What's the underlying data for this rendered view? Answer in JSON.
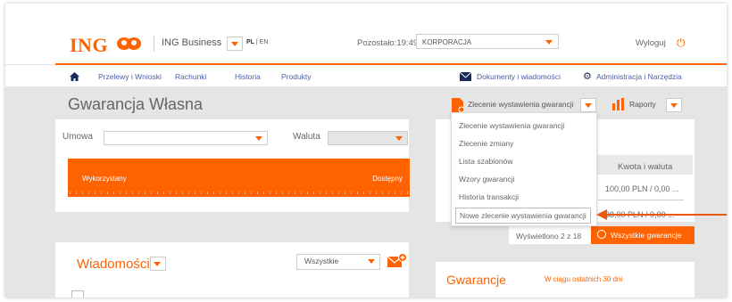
{
  "header": {
    "logo": "ING",
    "business_label": "ING Business",
    "lang_pl": "PL",
    "lang_sep": " | ",
    "lang_en": "EN",
    "timer": "Pozostało:19:49",
    "company": "KORPORACJA",
    "logout": "Wyloguj"
  },
  "nav": {
    "items": [
      "Przelewy i Wnioski",
      "Rachunki",
      "Historia",
      "Produkty"
    ],
    "documents": "Dokumenty i wiadomości",
    "admin": "Administracja i Narzędzia"
  },
  "page": {
    "title": "Gwarancja Własna",
    "umowa_label": "Umowa",
    "waluta_label": "Waluta",
    "bar_left": "Wykorzystany",
    "bar_right": "Dostępny",
    "messages_title": "Wiadomości",
    "messages_filter": "Wszystkie"
  },
  "right": {
    "order_dropdown": "Zlecenie wystawienia gwarancji",
    "reports": "Raporty",
    "col_amount": "Kwota i waluta",
    "row1_amount": "100,00 PLN / 0,00 ...",
    "row2_amount": "38,00 PLN / 0,00 ...",
    "shown": "Wyświetlono 2 z 18",
    "all_button": "Wszystkie gwarancje",
    "guarantees_title": "Gwarancje",
    "guarantees_period": "W ciągu ostatnich 30 dni"
  },
  "menu": {
    "items": [
      "Zlecenie wystawienia gwarancji",
      "Zlecenie zmiany",
      "Lista szablonów",
      "Wzory gwarancji",
      "Historia transakcji",
      "Nowe zlecenie wystawienia gwarancji"
    ]
  },
  "colors": {
    "accent": "#ff6200",
    "nav_text": "#4a5fa8",
    "background": "#e5e5e5"
  }
}
